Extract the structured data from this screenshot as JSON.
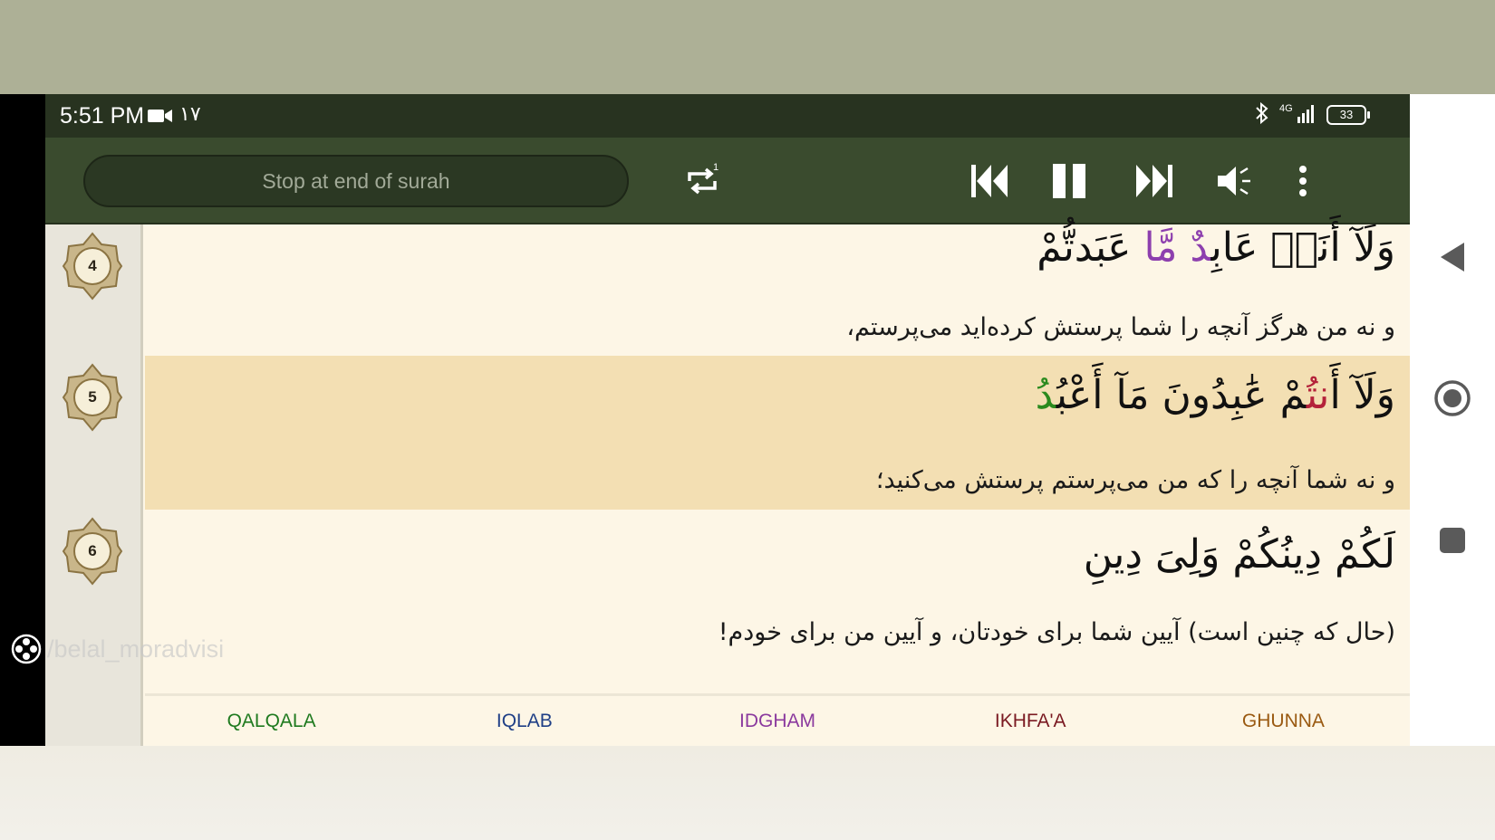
{
  "status_bar": {
    "time": "5:51 PM",
    "extra": "۱۷",
    "network": "4G",
    "battery": "33",
    "icons": [
      "video-camera-icon",
      "bluetooth-icon",
      "signal-icon",
      "battery-icon"
    ]
  },
  "toolbar": {
    "stop_label": "Stop at end of surah",
    "repeat_count": "1",
    "buttons": [
      "repeat-icon",
      "skip-previous-icon",
      "pause-icon",
      "skip-next-icon",
      "volume-icon",
      "more-vert-icon"
    ]
  },
  "verses": [
    {
      "number": "4",
      "arabic": [
        "وَلَآ أَنَا۠ عَابِ",
        "دٌ مَّا",
        " عَبَدتُّمْ"
      ],
      "translation": "و نه من هرگز آنچه را شما پرستش کرده‌اید می‌پرستم،"
    },
    {
      "number": "5",
      "arabic": [
        "وَلَآ أَ",
        "نتُ",
        "مْ عَٰبِدُونَ مَآ أَعْبُ",
        "دُ"
      ],
      "translation": "و نه شما آنچه را که من می‌پرستم پرستش می‌کنید؛"
    },
    {
      "number": "6",
      "arabic": [
        "لَكُمْ دِينُكُمْ وَلِىَ دِينِ"
      ],
      "translation": "(حال که چنین است) آیین شما برای خودتان، و آیین من برای خودم!"
    }
  ],
  "legend": [
    {
      "label": "QALQALA",
      "color": "#1f7a1f"
    },
    {
      "label": "IQLAB",
      "color": "#1f3f86"
    },
    {
      "label": "IDGHAM",
      "color": "#8b3a9e"
    },
    {
      "label": "IKHFA'A",
      "color": "#7a1a22"
    },
    {
      "label": "GHUNNA",
      "color": "#9a5a12"
    }
  ],
  "watermark": "/belal_moradvisi",
  "colors": {
    "toolbar": "#3a4b2e",
    "status_bar": "#283320",
    "active_verse": "#f3dfb3",
    "page": "#fdf6e6"
  },
  "nav": [
    "back-icon",
    "home-icon",
    "recents-icon"
  ]
}
